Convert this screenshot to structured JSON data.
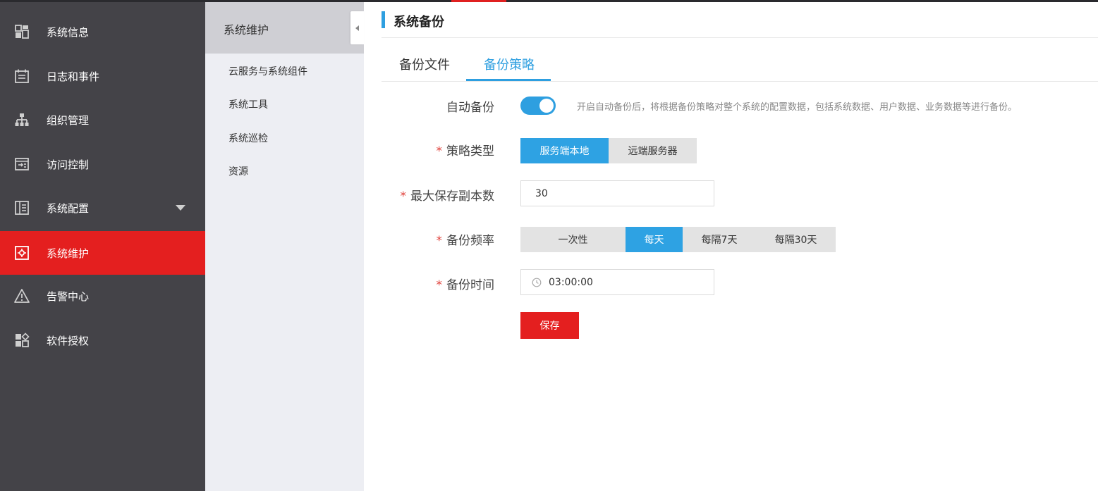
{
  "nav": {
    "items": [
      {
        "label": "系统信息",
        "icon": "dashboard-icon"
      },
      {
        "label": "日志和事件",
        "icon": "calendar-log-icon"
      },
      {
        "label": "组织管理",
        "icon": "org-tree-icon"
      },
      {
        "label": "访问控制",
        "icon": "access-control-icon"
      },
      {
        "label": "系统配置",
        "icon": "config-list-icon"
      },
      {
        "label": "系统维护",
        "icon": "maintenance-icon"
      },
      {
        "label": "告警中心",
        "icon": "warning-icon"
      },
      {
        "label": "软件授权",
        "icon": "license-icon"
      }
    ],
    "active_index": 5
  },
  "submenu": {
    "title": "系统维护",
    "items": [
      "云服务与系统组件",
      "系统工具",
      "系统巡检",
      "资源"
    ]
  },
  "page": {
    "title": "系统备份",
    "tabs": [
      "备份文件",
      "备份策略"
    ],
    "active_tab_index": 1
  },
  "form": {
    "auto_backup": {
      "label": "自动备份",
      "enabled": true,
      "hint": "开启自动备份后，将根据备份策略对整个系统的配置数据，包括系统数据、用户数据、业务数据等进行备份。"
    },
    "policy_type": {
      "label": "策略类型",
      "options": [
        "服务端本地",
        "远端服务器"
      ],
      "selected": "服务端本地"
    },
    "max_copies": {
      "label": "最大保存副本数",
      "value": "30"
    },
    "frequency": {
      "label": "备份频率",
      "options": [
        "一次性",
        "每天",
        "每隔7天",
        "每隔30天"
      ],
      "selected": "每天"
    },
    "backup_time": {
      "label": "备份时间",
      "value": "03:00:00"
    },
    "save_label": "保存"
  },
  "colors": {
    "accent_red": "#e41f1f",
    "accent_blue": "#2e9fe0",
    "nav_bg": "#444348"
  }
}
